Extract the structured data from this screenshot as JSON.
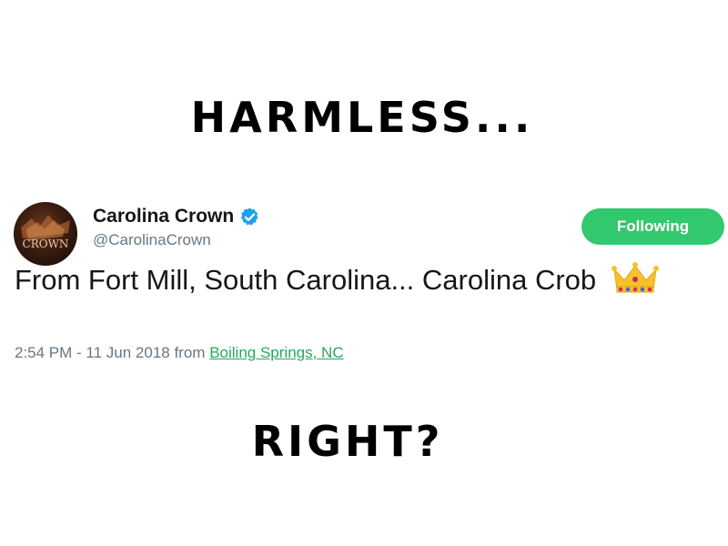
{
  "captions": {
    "top": "HARMLESS...",
    "bottom": "RIGHT?"
  },
  "tweet": {
    "display_name": "Carolina Crown",
    "handle": "@CarolinaCrown",
    "verified": true,
    "follow_button_label": "Following",
    "text": "From Fort Mill, South Carolina... Carolina Crob",
    "emoji": "crown-icon",
    "timestamp": "2:54 PM - 11 Jun 2018 from",
    "location": "Boiling Springs, NC",
    "avatar_text": "CROWN"
  },
  "colors": {
    "follow_button_bg": "#31c86e",
    "location_link": "#27a85b",
    "verified_badge": "#1da1f2",
    "secondary_text": "#657786"
  }
}
